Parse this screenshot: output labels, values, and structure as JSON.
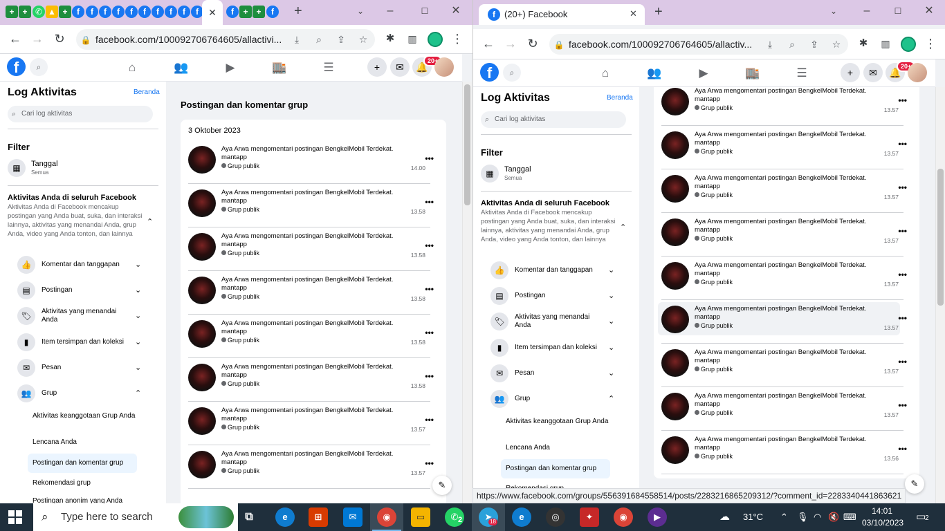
{
  "left_window": {
    "url": "facebook.com/100092706764605/allactivi...",
    "badge": "20+",
    "scroll_fraction": 0.3
  },
  "right_window": {
    "tab_title": "(20+) Facebook",
    "url": "facebook.com/100092706764605/allactiv...",
    "badge": "20+",
    "status_url": "https://www.facebook.com/groups/556391684558514/posts/2283216865209312/?comment_id=2283340441863621"
  },
  "sidebar": {
    "title": "Log Aktivitas",
    "home_link": "Beranda",
    "search_placeholder": "Cari log aktivitas",
    "filter_heading": "Filter",
    "date_label": "Tanggal",
    "date_value": "Semua",
    "activity_title": "Aktivitas Anda di seluruh Facebook",
    "activity_desc": "Aktivitas Anda di Facebook mencakup postingan yang Anda buat, suka, dan interaksi lainnya, aktivitas yang menandai Anda, grup Anda, video yang Anda tonton, dan lainnya",
    "activity_desc_right": "Aktivitas Anda di Facebook mencakup postingan yang Anda buat, suka, dan interaksi lainnya, aktivitas yang menandai Anda, grup Anda, video yang Anda tonton, dan lainnya",
    "categories": [
      {
        "label": "Komentar dan tanggapan",
        "icon": "thumbs-up-icon"
      },
      {
        "label": "Postingan",
        "icon": "post-icon"
      },
      {
        "label": "Aktivitas yang menandai Anda",
        "icon": "tag-icon"
      },
      {
        "label": "Item tersimpan dan koleksi",
        "icon": "bookmark-icon"
      },
      {
        "label": "Pesan",
        "icon": "messenger-icon"
      },
      {
        "label": "Grup",
        "icon": "group-icon"
      }
    ],
    "group_subitems": [
      "Aktivitas keanggotaan Grup Anda",
      "Lencana Anda",
      "Postingan dan komentar grup",
      "Rekomendasi grup",
      "Postingan anonim yang Anda"
    ],
    "right_cut_item": "Rekomendasi grup"
  },
  "feed": {
    "title": "Postingan dan komentar grup",
    "date": "3 Oktober 2023",
    "entry_text": "Aya Arwa mengomentari postingan BengkelMobil Terdekat.",
    "entry_comment": "mantapp",
    "privacy": "Grup publik",
    "left_times": [
      "14.00",
      "13.58",
      "13.58",
      "13.58",
      "13.58",
      "13.58",
      "13.57",
      "13.57"
    ],
    "right_times": [
      "13.57",
      "13.57",
      "13.57",
      "13.57",
      "13.57",
      "13.57",
      "13.57",
      "13.57",
      "13.56"
    ]
  },
  "taskbar": {
    "search_placeholder": "Type here to search",
    "weather": "31°C",
    "time": "14:01",
    "date": "03/10/2023",
    "notifications": "2",
    "whatsapp_count": "2",
    "telegram_count": "18"
  },
  "colors": {
    "fb_blue": "#1877f2",
    "tab_strip": "#dcc8e6",
    "taskbar": "#1f2f3c",
    "badge_red": "#e41e3f"
  }
}
